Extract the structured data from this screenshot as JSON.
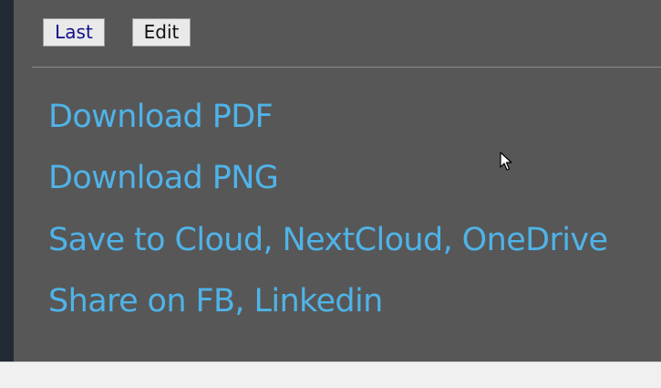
{
  "toolbar": {
    "last_label": "Last",
    "edit_label": "Edit"
  },
  "links": [
    {
      "label": "Download PDF"
    },
    {
      "label": "Download PNG"
    },
    {
      "label": "Save to Cloud, NextCloud, OneDrive"
    },
    {
      "label": "Share on FB, Linkedin"
    }
  ],
  "colors": {
    "panel_bg": "#575757",
    "link": "#4fb3e8",
    "sidebar": "#232a33"
  },
  "icons": {
    "cursor": "mouse-pointer-icon"
  }
}
